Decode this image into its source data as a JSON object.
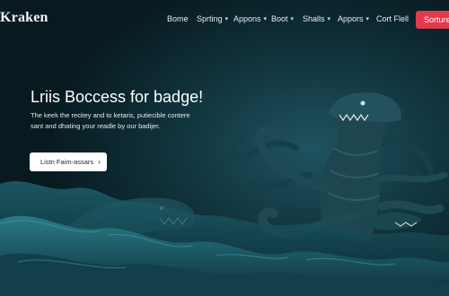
{
  "brand": {
    "name": "Kraken"
  },
  "nav": {
    "items": [
      {
        "label": "Bome",
        "dropdown": false
      },
      {
        "label": "Sprting",
        "dropdown": true
      },
      {
        "label": "Appons",
        "dropdown": true
      },
      {
        "label": "Boot",
        "dropdown": true
      },
      {
        "label": "Shalls",
        "dropdown": true
      },
      {
        "label": "Appors",
        "dropdown": true
      },
      {
        "label": "Cort Flell",
        "dropdown": false
      }
    ],
    "cta_label": "Sorture"
  },
  "hero": {
    "headline": "Lriis Boccess for badge!",
    "subtext_line1": "The keek the recitey and to ketaris, putiecible contere",
    "subtext_line2": "sant and dhating your readle by our badijer.",
    "button_label": "Listn Faim-assars",
    "button_icon": "arrow-right-icon"
  },
  "colors": {
    "background": "#0a1f26",
    "accent": "#e23a4a",
    "creature": "#1d4650",
    "waves": "#0f3a45"
  }
}
